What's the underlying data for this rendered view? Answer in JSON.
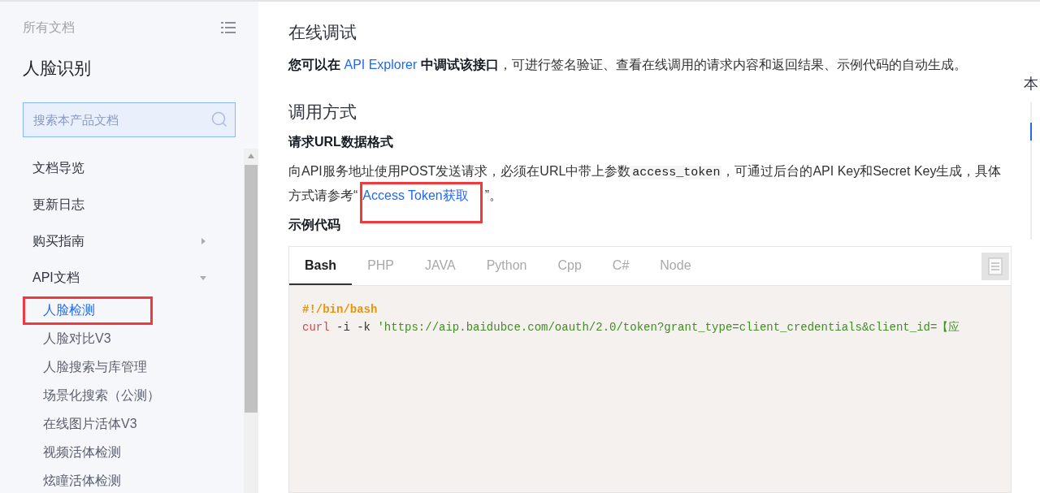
{
  "sidebar": {
    "all_docs": "所有文档",
    "product": "人脸识别",
    "search": {
      "placeholder": "搜索本产品文档"
    },
    "items": [
      {
        "label": "文档导览",
        "kind": "page",
        "selected": false
      },
      {
        "label": "更新日志",
        "kind": "page",
        "selected": false
      },
      {
        "label": "购买指南",
        "kind": "folder",
        "expanded": false,
        "selected": false
      },
      {
        "label": "API文档",
        "kind": "folder",
        "expanded": true,
        "selected": false,
        "children": [
          {
            "label": "人脸检测",
            "selected": true,
            "highlighted": true
          },
          {
            "label": "人脸对比V3",
            "selected": false,
            "highlighted": false
          },
          {
            "label": "人脸搜索与库管理",
            "selected": false,
            "highlighted": false
          },
          {
            "label": "场景化搜索（公测）",
            "selected": false,
            "highlighted": false
          },
          {
            "label": "在线图片活体V3",
            "selected": false,
            "highlighted": false
          },
          {
            "label": "视频活体检测",
            "selected": false,
            "highlighted": false
          },
          {
            "label": "炫瞳活体检测",
            "selected": false,
            "highlighted": false
          }
        ]
      }
    ]
  },
  "content": {
    "sections": [
      {
        "heading": "在线调试",
        "blocks": [
          {
            "kind": "paragraph",
            "segments": [
              {
                "kind": "bold",
                "text": "您可以在 "
              },
              {
                "kind": "link",
                "text": "API Explorer",
                "highlighted": false
              },
              {
                "kind": "bold",
                "text": " 中调试该接口"
              },
              {
                "kind": "text",
                "text": "，可进行签名验证、查看在线调用的请求内容和返回结果、示例代码的自动生成。"
              }
            ]
          }
        ]
      },
      {
        "heading": "调用方式",
        "blocks": [
          {
            "kind": "subheading",
            "text": "请求URL数据格式"
          },
          {
            "kind": "paragraph",
            "segments": [
              {
                "kind": "text",
                "text": "向API服务地址使用POST发送请求，必须在URL中带上参数"
              },
              {
                "kind": "code",
                "text": "access_token"
              },
              {
                "kind": "text",
                "text": "，可通过后台的API Key和Secret Key生成，具体方式请参考“"
              },
              {
                "kind": "link",
                "text": "Access Token获取",
                "highlighted": true
              },
              {
                "kind": "text",
                "text": "”。"
              }
            ]
          },
          {
            "kind": "subheading",
            "text": "示例代码"
          },
          {
            "kind": "code_panel",
            "tabs": [
              {
                "label": "Bash",
                "selected": true
              },
              {
                "label": "PHP",
                "selected": false
              },
              {
                "label": "JAVA",
                "selected": false
              },
              {
                "label": "Python",
                "selected": false
              },
              {
                "label": "Cpp",
                "selected": false
              },
              {
                "label": "C#",
                "selected": false
              },
              {
                "label": "Node",
                "selected": false
              }
            ],
            "lines": [
              [
                {
                  "kind": "comment",
                  "text": "#!/bin/bash"
                }
              ],
              [
                {
                  "kind": "command",
                  "text": "curl"
                },
                {
                  "kind": "plain",
                  "text": " -i -k "
                },
                {
                  "kind": "string",
                  "text": "'https://aip.baidubce.com/oauth/2.0/token?grant_type=client_credentials&client_id=【应"
                }
              ]
            ]
          }
        ]
      }
    ]
  },
  "toc": {
    "title": "本"
  }
}
